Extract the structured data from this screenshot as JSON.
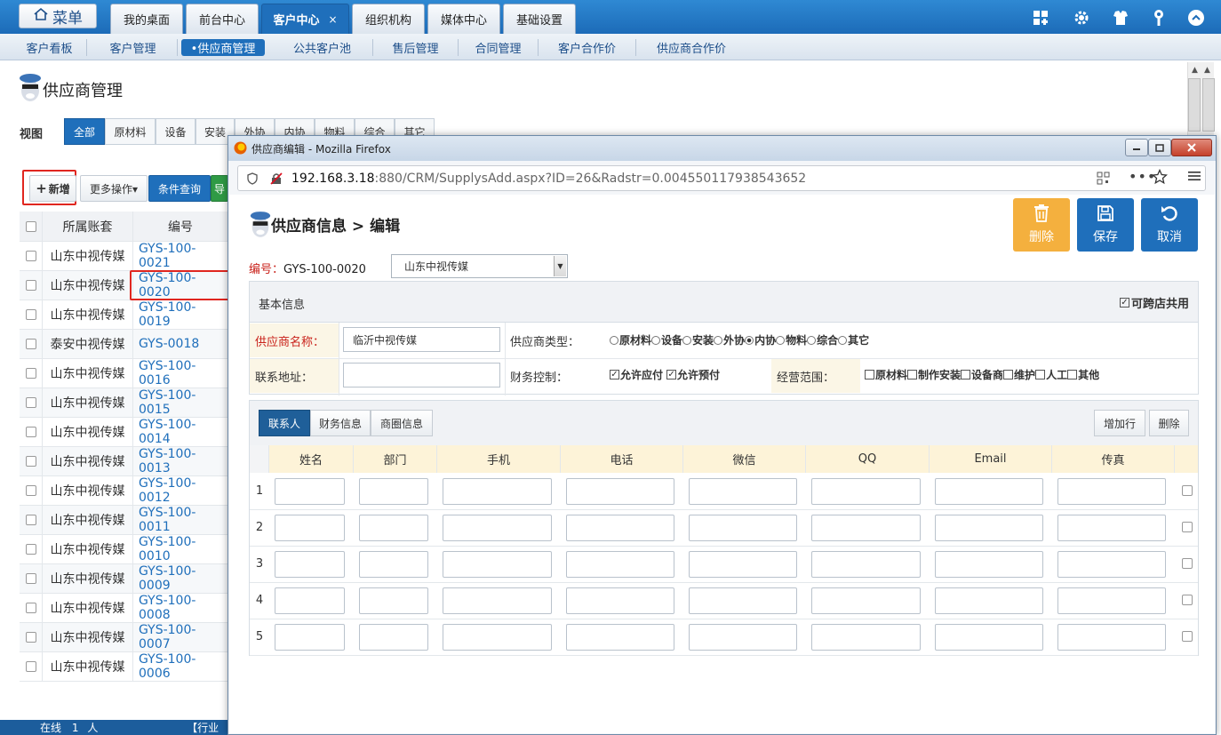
{
  "topbar": {
    "menu_label": "菜单",
    "tabs": [
      {
        "label": "我的桌面"
      },
      {
        "label": "前台中心"
      },
      {
        "label": "客户中心",
        "active": true,
        "close": "×"
      },
      {
        "label": "组织机构"
      },
      {
        "label": "媒体中心"
      },
      {
        "label": "基础设置"
      }
    ],
    "icons": [
      "grid-icon",
      "gear-icon",
      "shirt-icon",
      "key-icon",
      "chevron-up-icon"
    ]
  },
  "subnav": {
    "items": [
      "客户看板",
      "客户管理",
      "•供应商管理",
      "公共客户池",
      "售后管理",
      "合同管理",
      "客户合作价",
      "供应商合作价"
    ],
    "active_index": 2
  },
  "page": {
    "title": "供应商管理",
    "view_label": "视图",
    "view_tabs": [
      "全部",
      "原材料",
      "设备",
      "安装",
      "外协",
      "内协",
      "物料",
      "综合",
      "其它"
    ],
    "toolbar": {
      "add": "新增",
      "more": "更多操作▾",
      "query": "条件查询",
      "export": "导"
    }
  },
  "grid": {
    "columns": [
      "所属账套",
      "编号"
    ],
    "rows": [
      [
        "山东中视传媒",
        "GYS-100-0021"
      ],
      [
        "山东中视传媒",
        "GYS-100-0020"
      ],
      [
        "山东中视传媒",
        "GYS-100-0019"
      ],
      [
        "泰安中视传媒",
        "GYS-0018"
      ],
      [
        "山东中视传媒",
        "GYS-100-0016"
      ],
      [
        "山东中视传媒",
        "GYS-100-0015"
      ],
      [
        "山东中视传媒",
        "GYS-100-0014"
      ],
      [
        "山东中视传媒",
        "GYS-100-0013"
      ],
      [
        "山东中视传媒",
        "GYS-100-0012"
      ],
      [
        "山东中视传媒",
        "GYS-100-0011"
      ],
      [
        "山东中视传媒",
        "GYS-100-0010"
      ],
      [
        "山东中视传媒",
        "GYS-100-0009"
      ],
      [
        "山东中视传媒",
        "GYS-100-0008"
      ],
      [
        "山东中视传媒",
        "GYS-100-0007"
      ],
      [
        "山东中视传媒",
        "GYS-100-0006"
      ]
    ]
  },
  "status": {
    "online_prefix": "在线",
    "online_count": "1",
    "online_suffix": "人",
    "extra": "【行业"
  },
  "popup": {
    "window_title": "供应商编辑 - Mozilla Firefox",
    "url_host": "192.168.3.18",
    "url_rest": ":880/CRM/SupplysAdd.aspx?ID=26&Radstr=0.004550117938543652",
    "heading": "供应商信息 > 编辑",
    "buttons": {
      "delete": "删除",
      "save": "保存",
      "cancel": "取消"
    },
    "code_label": "编号：",
    "code_value": "GYS-100-0020",
    "company_select": "山东中视传媒",
    "basic": {
      "title": "基本信息",
      "cross_share": "可跨店共用",
      "name_label": "供应商名称：",
      "name_value": "临沂中视传媒",
      "type_label": "供应商类型：",
      "types": [
        "原材料",
        "设备",
        "安装",
        "外协",
        "内协",
        "物料",
        "综合",
        "其它"
      ],
      "type_selected": "内协",
      "addr_label": "联系地址：",
      "addr_value": "",
      "finance_label": "财务控制：",
      "finance": [
        "允许应付",
        "允许预付"
      ],
      "scope_label": "经营范围：",
      "scope": [
        "原材料",
        "制作安装",
        "设备商",
        "维护",
        "人工",
        "其他"
      ]
    },
    "contacts": {
      "tabs": [
        "联系人",
        "财务信息",
        "商圈信息"
      ],
      "add_row": "增加行",
      "delete": "删除",
      "columns": [
        "姓名",
        "部门",
        "手机",
        "电话",
        "微信",
        "QQ",
        "Email",
        "传真"
      ],
      "rows": [
        "1",
        "2",
        "3",
        "4",
        "5"
      ]
    }
  }
}
